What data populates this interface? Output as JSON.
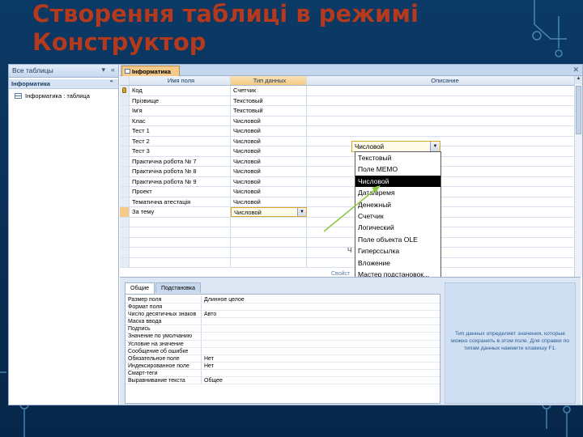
{
  "slide": {
    "title": "Створення таблиці в режимі Конструктор"
  },
  "nav": {
    "header": "Все таблицы",
    "group": "Інформатика",
    "items": [
      {
        "label": "Інформатика : таблица"
      }
    ]
  },
  "document": {
    "tab_label": "Інформатика"
  },
  "grid": {
    "headers": {
      "name": "Имя поля",
      "type": "Тип данных",
      "desc": "Описание"
    },
    "rows": [
      {
        "name": "Код",
        "type": "Счетчик",
        "key": true
      },
      {
        "name": "Прізвище",
        "type": "Текстовый"
      },
      {
        "name": "Ім'я",
        "type": "Текстовый"
      },
      {
        "name": "Клас",
        "type": "Числовой"
      },
      {
        "name": "Тест 1",
        "type": "Числовой"
      },
      {
        "name": "Тест 2",
        "type": "Числовой"
      },
      {
        "name": "Тест 3",
        "type": "Числовой"
      },
      {
        "name": "Практична робота № 7",
        "type": "Числовой"
      },
      {
        "name": "Практична робота № 8",
        "type": "Числовой"
      },
      {
        "name": "Практична робота № 9",
        "type": "Числовой"
      },
      {
        "name": "Проект",
        "type": "Числовой"
      },
      {
        "name": "Тематична атестація",
        "type": "Числовой"
      },
      {
        "name": "За тему",
        "type": "Числовой",
        "current": true
      }
    ]
  },
  "dropdown": {
    "value": "Числовой",
    "options": [
      "Текстовый",
      "Поле MEMO",
      "Числовой",
      "Дата/время",
      "Денежный",
      "Счетчик",
      "Логический",
      "Поле объекта OLE",
      "Гиперссылка",
      "Вложение",
      "Мастер подстановок..."
    ],
    "selected": "Числовой"
  },
  "stray": {
    "a": "Ч",
    "b": "Свойст"
  },
  "properties": {
    "tabs": [
      "Общие",
      "Подстановка"
    ],
    "active_tab": "Общие",
    "rows": [
      {
        "k": "Размер поля",
        "v": "Длинное целое"
      },
      {
        "k": "Формат поля",
        "v": ""
      },
      {
        "k": "Число десятичных знаков",
        "v": "Авто"
      },
      {
        "k": "Маска ввода",
        "v": ""
      },
      {
        "k": "Подпись",
        "v": ""
      },
      {
        "k": "Значение по умолчанию",
        "v": ""
      },
      {
        "k": "Условие на значение",
        "v": ""
      },
      {
        "k": "Сообщение об ошибке",
        "v": ""
      },
      {
        "k": "Обязательное поле",
        "v": "Нет"
      },
      {
        "k": "Индексированное поле",
        "v": "Нет"
      },
      {
        "k": "Смарт-теги",
        "v": ""
      },
      {
        "k": "Выравнивание текста",
        "v": "Общее"
      }
    ],
    "help": "Тип данных определяет значения, которые можно сохранять в этом поле. Для справки по типам данных нажмите клавишу F1."
  },
  "colors": {
    "title": "#b43a1f",
    "background": "#0b3a66",
    "accent_tab": "#f5c98a",
    "arrow": "#8cc63f"
  }
}
